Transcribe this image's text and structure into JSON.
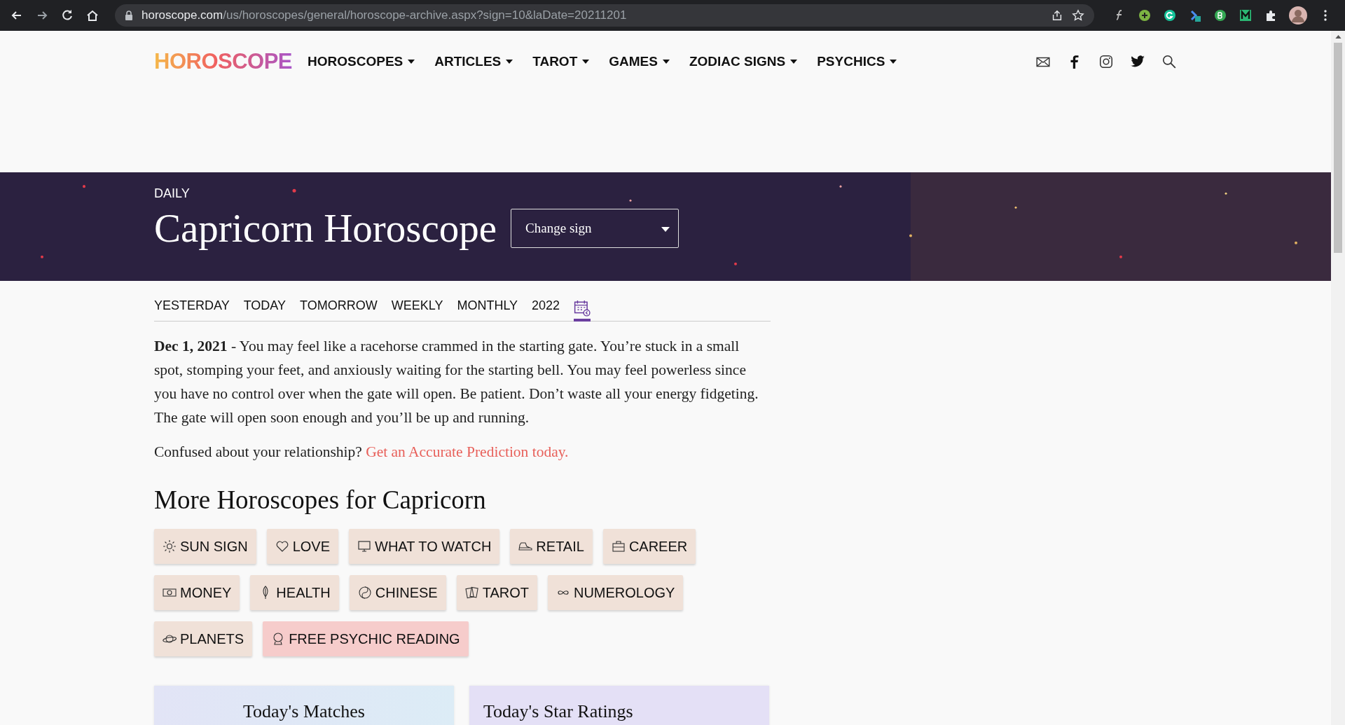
{
  "browser": {
    "url_host": "horoscope.com",
    "url_path": "/us/horoscopes/general/horoscope-archive.aspx?sign=10&laDate=20211201"
  },
  "nav": {
    "logo": "HOROSCOPE",
    "items": [
      {
        "label": "HOROSCOPES"
      },
      {
        "label": "ARTICLES"
      },
      {
        "label": "TAROT"
      },
      {
        "label": "GAMES"
      },
      {
        "label": "ZODIAC SIGNS"
      },
      {
        "label": "PSYCHICS"
      }
    ]
  },
  "banner": {
    "eyebrow": "DAILY",
    "title": "Capricorn Horoscope",
    "sign_select": {
      "placeholder": "Change sign"
    }
  },
  "tabs": [
    {
      "kind": "text",
      "label": "YESTERDAY",
      "selected": false
    },
    {
      "kind": "text",
      "label": "TODAY",
      "selected": false
    },
    {
      "kind": "text",
      "label": "TOMORROW",
      "selected": false
    },
    {
      "kind": "text",
      "label": "WEEKLY",
      "selected": false
    },
    {
      "kind": "text",
      "label": "MONTHLY",
      "selected": false
    },
    {
      "kind": "text",
      "label": "2022",
      "selected": false
    },
    {
      "kind": "calendar",
      "selected": true
    }
  ],
  "reading": {
    "text": "**Dec 1, 2021** - You may feel like a racehorse crammed in the starting gate. You’re stuck in a small spot, stomping your feet, and anxiously waiting for the starting bell. You may feel powerless since you have no control over when the gate will open. Be patient. Don’t waste all your energy fidgeting. The gate will open soon enough and you’ll be up and running.",
    "prompt": "Confused about your relationship?",
    "link": "Get an Accurate Prediction today."
  },
  "more": {
    "heading": "More Horoscopes for Capricorn",
    "buttons": [
      {
        "label": "SUN SIGN",
        "highlighted": false
      },
      {
        "label": "LOVE",
        "highlighted": false
      },
      {
        "label": "WHAT TO WATCH",
        "highlighted": false
      },
      {
        "label": "RETAIL",
        "highlighted": false
      },
      {
        "label": "CAREER",
        "highlighted": false
      },
      {
        "label": "MONEY",
        "highlighted": false
      },
      {
        "label": "HEALTH",
        "highlighted": false
      },
      {
        "label": "CHINESE",
        "highlighted": false
      },
      {
        "label": "TAROT",
        "highlighted": false
      },
      {
        "label": "NUMEROLOGY",
        "highlighted": false
      },
      {
        "label": "PLANETS",
        "highlighted": false
      },
      {
        "label": "FREE PSYCHIC READING",
        "highlighted": true
      }
    ]
  },
  "cards": [
    {
      "title": "Today's Matches"
    },
    {
      "title": "Today's Star Ratings"
    }
  ]
}
